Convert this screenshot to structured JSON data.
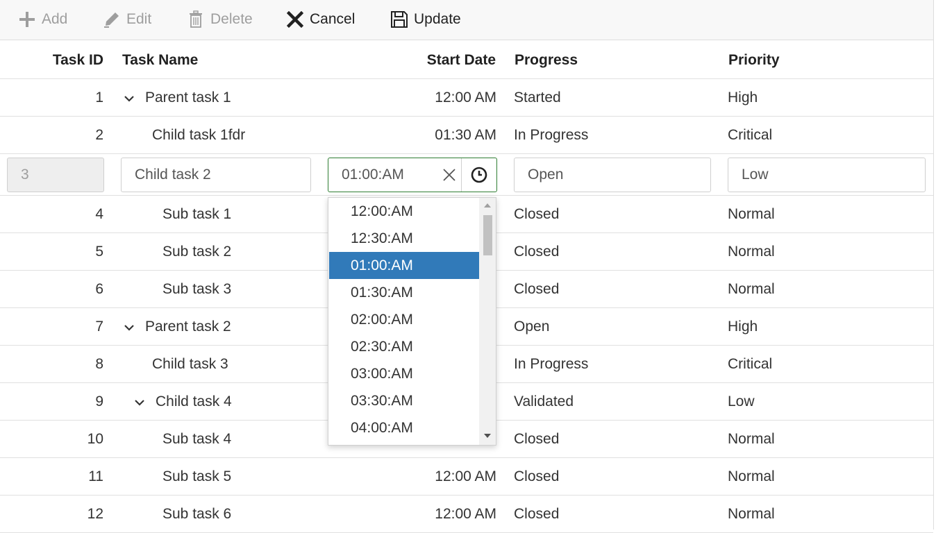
{
  "toolbar": {
    "add": "Add",
    "edit": "Edit",
    "delete": "Delete",
    "cancel": "Cancel",
    "update": "Update"
  },
  "columns": {
    "task_id": "Task ID",
    "task_name": "Task Name",
    "start_date": "Start Date",
    "progress": "Progress",
    "priority": "Priority"
  },
  "rows": [
    {
      "id": "1",
      "name": "Parent task 1",
      "date": "12:00 AM",
      "progress": "Started",
      "priority": "High"
    },
    {
      "id": "2",
      "name": "Child task 1fdr",
      "date": "01:30 AM",
      "progress": "In Progress",
      "priority": "Critical"
    },
    {
      "id": "4",
      "name": "Sub task 1",
      "date": "",
      "progress": "Closed",
      "priority": "Normal"
    },
    {
      "id": "5",
      "name": "Sub task 2",
      "date": "",
      "progress": "Closed",
      "priority": "Normal"
    },
    {
      "id": "6",
      "name": "Sub task 3",
      "date": "",
      "progress": "Closed",
      "priority": "Normal"
    },
    {
      "id": "7",
      "name": "Parent task 2",
      "date": "",
      "progress": "Open",
      "priority": "High"
    },
    {
      "id": "8",
      "name": "Child task 3",
      "date": "",
      "progress": "In Progress",
      "priority": "Critical"
    },
    {
      "id": "9",
      "name": "Child task 4",
      "date": "",
      "progress": "Validated",
      "priority": "Low"
    },
    {
      "id": "10",
      "name": "Sub task 4",
      "date": "",
      "progress": "Closed",
      "priority": "Normal"
    },
    {
      "id": "11",
      "name": "Sub task 5",
      "date": "12:00 AM",
      "progress": "Closed",
      "priority": "Normal"
    },
    {
      "id": "12",
      "name": "Sub task 6",
      "date": "12:00 AM",
      "progress": "Closed",
      "priority": "Normal"
    }
  ],
  "edit_row": {
    "id": "3",
    "name": "Child task 2",
    "time": "01:00:AM",
    "progress": "Open",
    "priority": "Low"
  },
  "time_options": [
    "12:00:AM",
    "12:30:AM",
    "01:00:AM",
    "01:30:AM",
    "02:00:AM",
    "02:30:AM",
    "03:00:AM",
    "03:30:AM",
    "04:00:AM"
  ],
  "selected_time": "01:00:AM",
  "colors": {
    "accent": "#317ab9",
    "focus_border": "#2e7d32"
  }
}
